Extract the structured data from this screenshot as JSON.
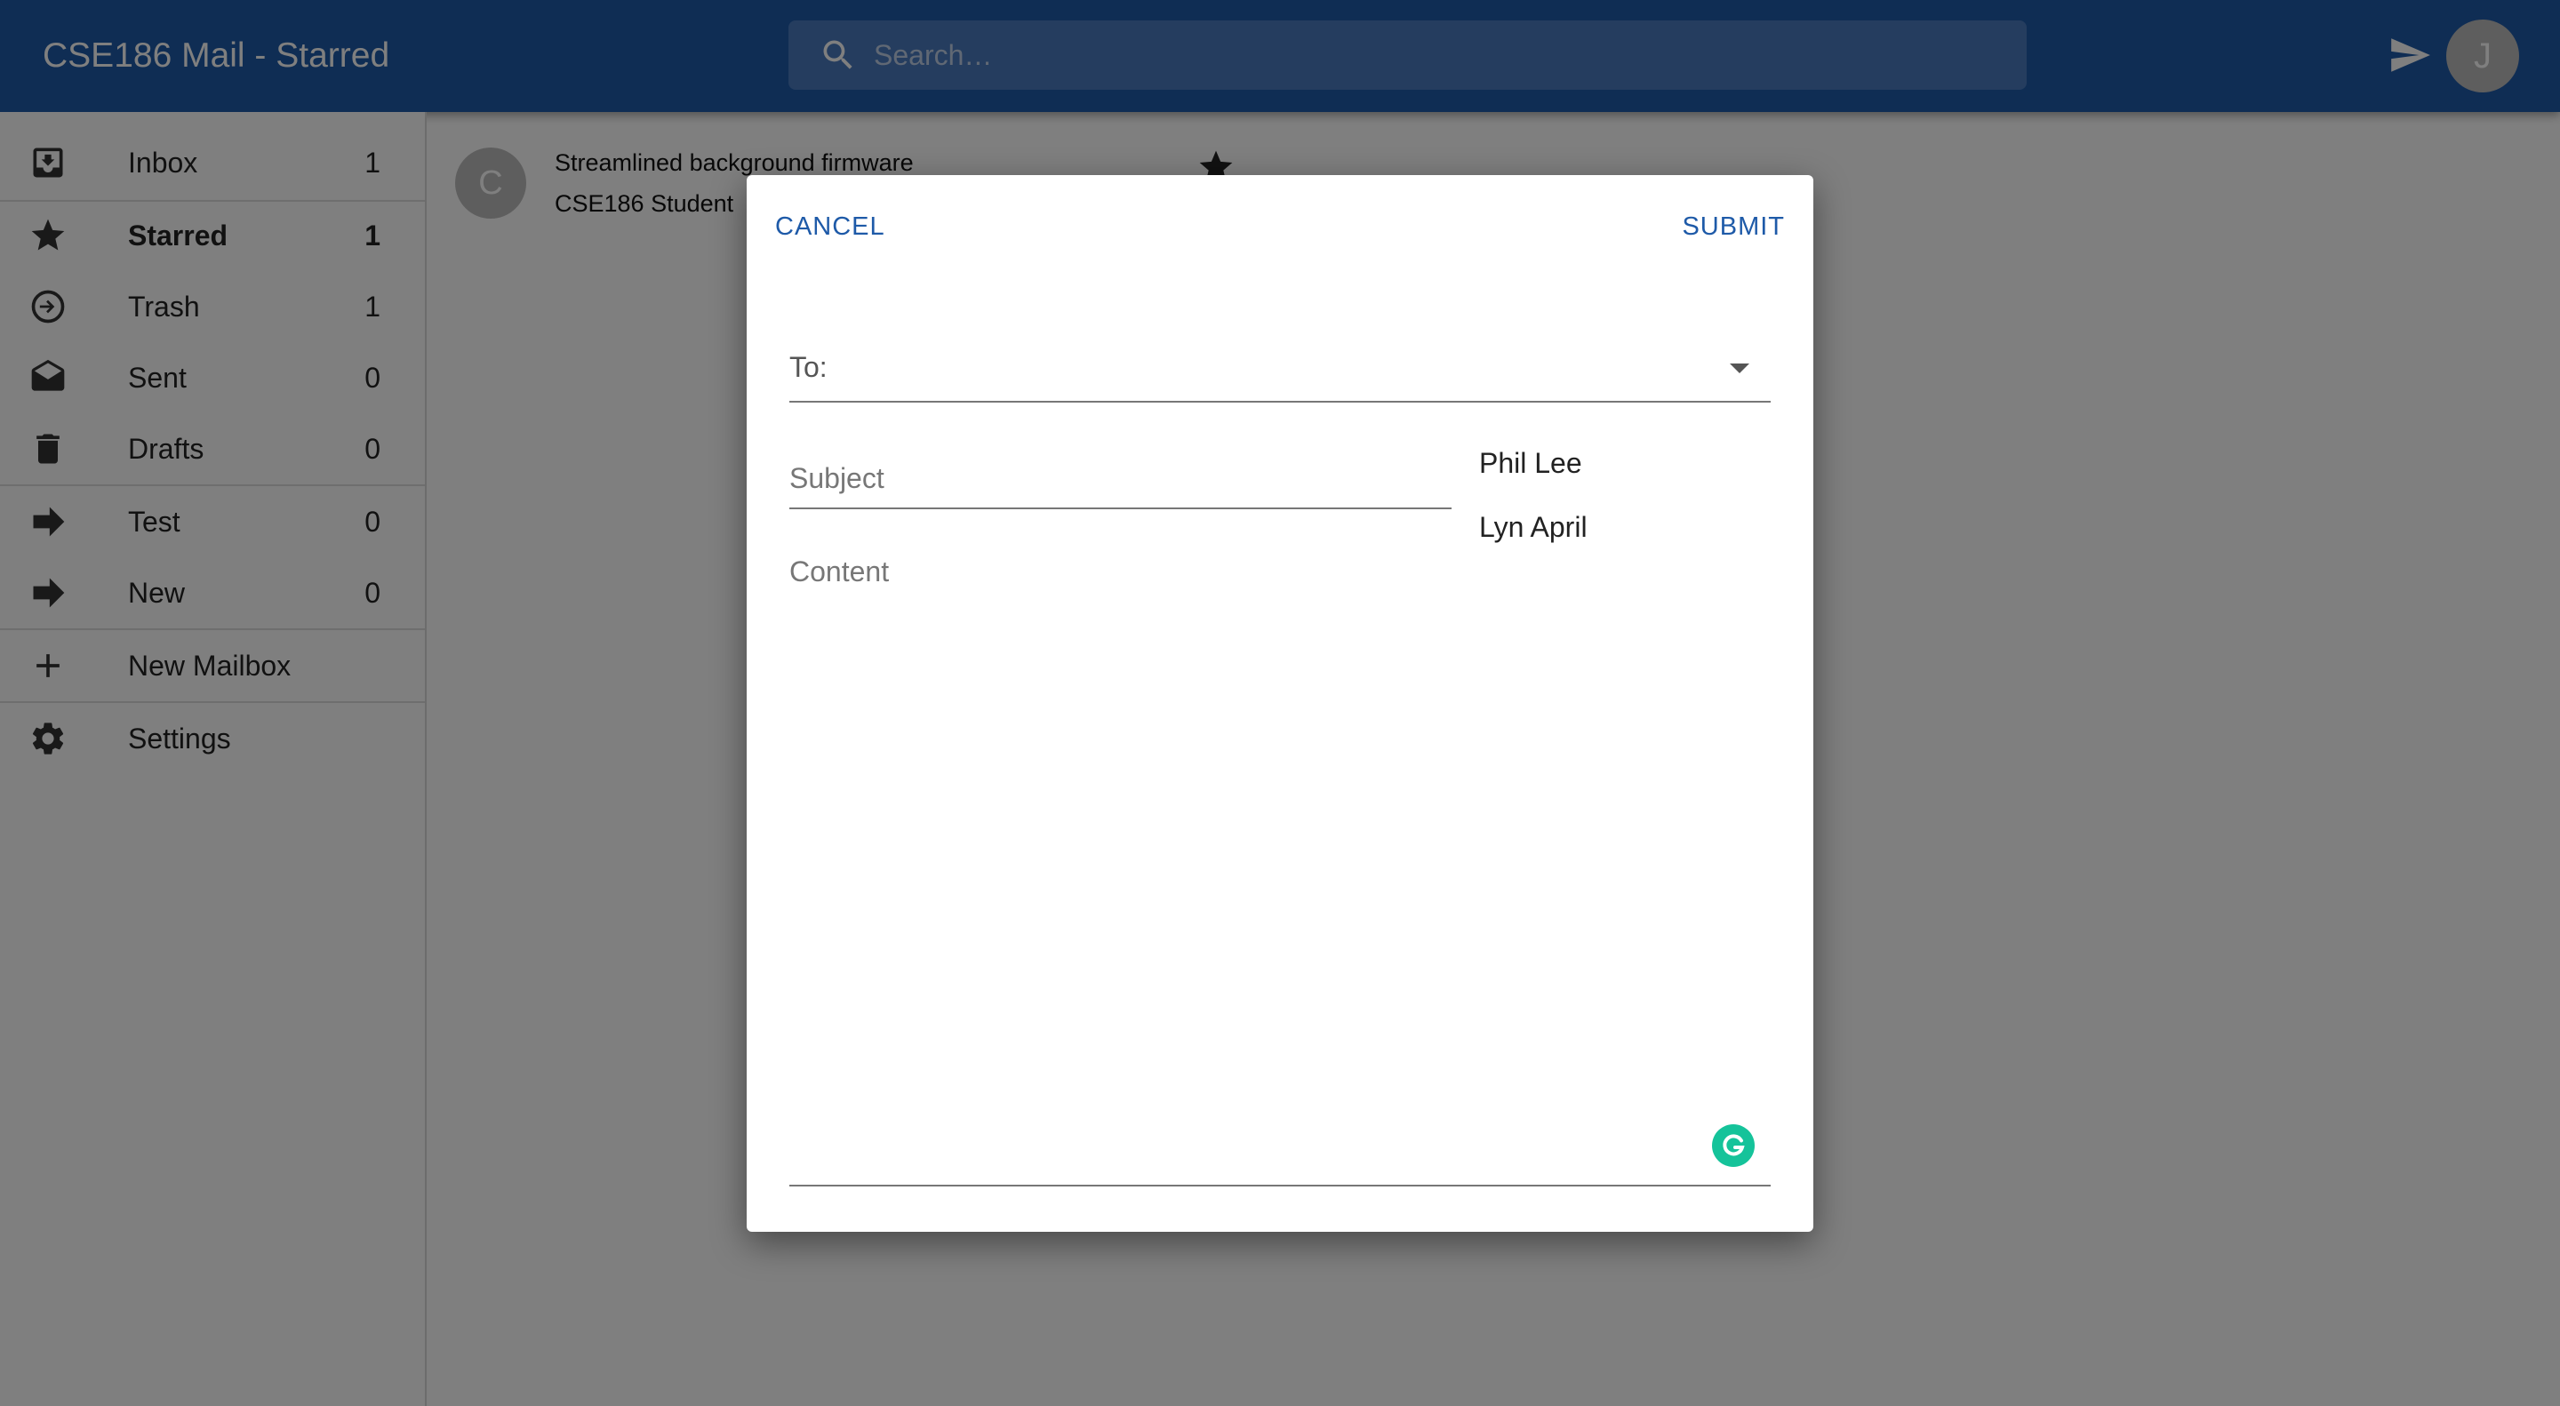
{
  "appbar": {
    "title": "CSE186 Mail - Starred",
    "search_placeholder": "Search…",
    "avatar_initial": "J",
    "icons": {
      "search": "search-icon",
      "send": "send-icon"
    },
    "color": "#1e5aa8"
  },
  "sidebar": {
    "items": [
      {
        "label": "Inbox",
        "count": "1",
        "icon": "inbox-icon"
      },
      {
        "label": "Starred",
        "count": "1",
        "icon": "star-icon",
        "active": true
      },
      {
        "label": "Trash",
        "count": "1",
        "icon": "trash-arrow-icon"
      },
      {
        "label": "Sent",
        "count": "0",
        "icon": "open-envelope-icon"
      },
      {
        "label": "Drafts",
        "count": "0",
        "icon": "bin-icon"
      },
      {
        "label": "Test",
        "count": "0",
        "icon": "arrow-right-icon"
      },
      {
        "label": "New",
        "count": "0",
        "icon": "arrow-right-icon"
      }
    ],
    "new_mailbox": "New Mailbox",
    "settings": "Settings"
  },
  "email_list": [
    {
      "avatar": "C",
      "subject": "Streamlined background firmware",
      "from": "CSE186 Student",
      "starred": true
    }
  ],
  "compose": {
    "cancel": "CANCEL",
    "submit": "SUBMIT",
    "to_label": "To:",
    "subject_placeholder": "Subject",
    "content_placeholder": "Content",
    "to_options": [
      "Phil Lee",
      "Lyn April"
    ],
    "accent": "#1e5aa8",
    "grammarly_color": "#15c39a"
  }
}
